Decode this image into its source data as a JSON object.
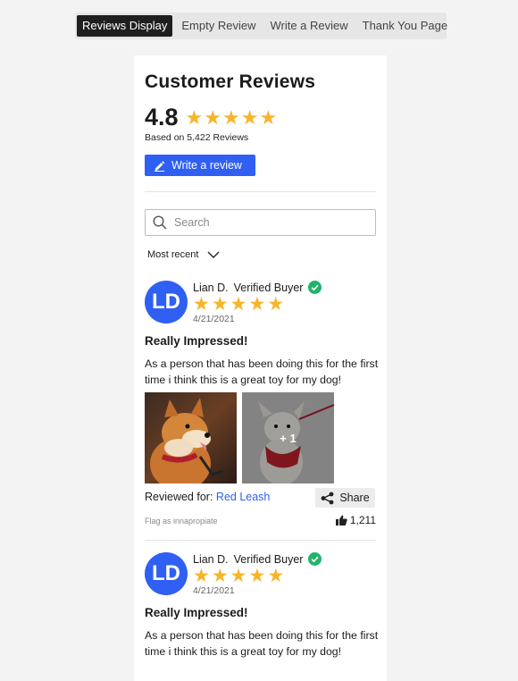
{
  "tabs": [
    {
      "label": "Reviews Display",
      "active": true
    },
    {
      "label": "Empty Review",
      "active": false
    },
    {
      "label": "Write a Review",
      "active": false
    },
    {
      "label": "Thank You Page",
      "active": false
    }
  ],
  "header": {
    "title": "Customer Reviews",
    "rating": "4.8",
    "rating_stars": 5,
    "based_on": "Based on 5,422 Reviews",
    "write_button": "Write a review"
  },
  "search": {
    "placeholder": "Search",
    "value": ""
  },
  "sort": {
    "selected": "Most recent"
  },
  "colors": {
    "accent": "#2f5ff3",
    "star": "#f7b52b",
    "verified": "#21b36b"
  },
  "reviews": [
    {
      "initials": "LD",
      "name": "Lian D.",
      "verified_label": "Verified Buyer",
      "stars": 5,
      "date": "4/21/2021",
      "title": "Really Impressed!",
      "body": "As a person that has been doing this for the first time i think this is a great toy for my dog!",
      "photos_extra": "+ 1",
      "reviewed_for_label": "Reviewed for:",
      "product": "Red Leash",
      "share_label": "Share",
      "flag_label": "Flag as innapropiate",
      "likes": "1,211"
    },
    {
      "initials": "LD",
      "name": "Lian D.",
      "verified_label": "Verified Buyer",
      "stars": 5,
      "date": "4/21/2021",
      "title": "Really Impressed!",
      "body": "As a person that has been doing this for the first time i think this is a great toy for my dog!"
    }
  ]
}
